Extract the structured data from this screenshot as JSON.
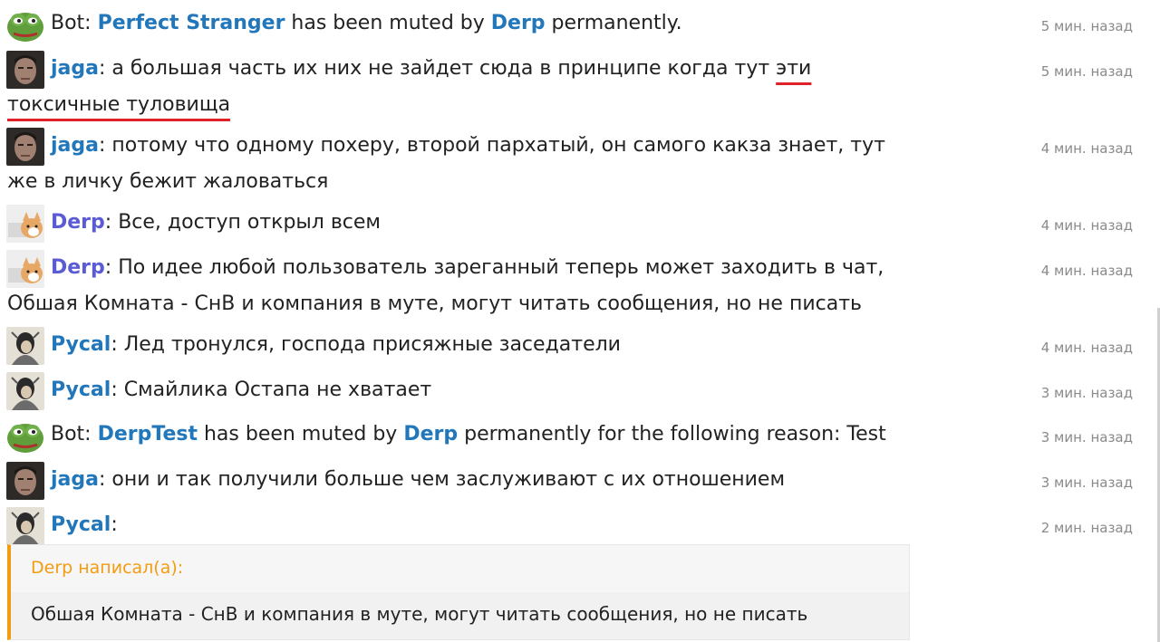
{
  "messages": [
    {
      "avatar": "pepe-frog-avatar",
      "prefix": "Bot: ",
      "user": "",
      "user_color": "",
      "body_parts": [
        "Perfect Stranger",
        " has been muted by ",
        "Derp",
        " permanently."
      ],
      "time": "5 мин. назад"
    },
    {
      "avatar": "jaga-avatar",
      "prefix": "",
      "user": "jaga",
      "sep": ": ",
      "body": "а большая часть их них не зайдет сюда в принципе когда тут ",
      "underlined": "эти токсичные туловища",
      "time": "5 мин. назад"
    },
    {
      "avatar": "jaga-avatar",
      "prefix": "",
      "user": "jaga",
      "sep": ": ",
      "body": "потому что одному похеру, второй пархатый, он самого какза знает, тут же в личку бежит жаловаться",
      "time": "4 мин. назад"
    },
    {
      "avatar": "derp-cat-avatar",
      "prefix": "",
      "user": "Derp",
      "sep": ": ",
      "body": "Все, доступ открыл всем",
      "time": "4 мин. назад"
    },
    {
      "avatar": "derp-cat-avatar",
      "prefix": "",
      "user": "Derp",
      "sep": ": ",
      "body": "По идее любой пользователь зареганный теперь может заходить в чат, Обшая Комната - СнВ и компания в муте, могут читать сообщения, но не писать",
      "time": "4 мин. назад"
    },
    {
      "avatar": "pycal-avatar",
      "prefix": "",
      "user": "Pycal",
      "sep": ": ",
      "body": "Лед тронулся, господа присяжные заседатели",
      "time": "4 мин. назад"
    },
    {
      "avatar": "pycal-avatar",
      "prefix": "",
      "user": "Pycal",
      "sep": ": ",
      "body": "Смайлика Остапа не хватает",
      "time": "3 мин. назад"
    },
    {
      "avatar": "pepe-frog-avatar",
      "prefix": "Bot: ",
      "body_parts": [
        "DerpTest",
        " has been muted by ",
        "Derp",
        " permanently for the following reason: Test"
      ],
      "time": "3 мин. назад"
    },
    {
      "avatar": "jaga-avatar",
      "prefix": "",
      "user": "jaga",
      "sep": ": ",
      "body": "они и так получили больше чем заслуживают с их отношением",
      "time": "3 мин. назад"
    },
    {
      "avatar": "pycal-avatar",
      "prefix": "",
      "user": "Pycal",
      "sep": ":",
      "body": "",
      "time": "2 мин. назад"
    }
  ],
  "quote": {
    "author": "Derp написал(а):",
    "text": "Обшая Комната - СнВ и компания в муте, могут читать сообщения, но не писать"
  },
  "colors": {
    "username_blue": "#2277bb",
    "username_purple": "#5b5bd6",
    "quote_accent": "#f39c12",
    "underline_red": "#e0202a"
  }
}
